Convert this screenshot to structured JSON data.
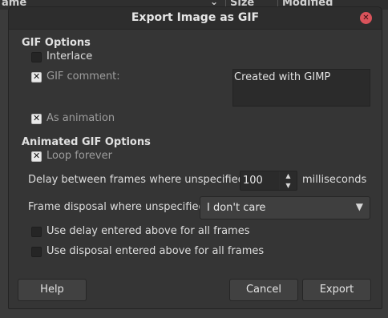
{
  "background": {
    "name_col": "ame",
    "size_col": "Size",
    "modified_col": "Modified"
  },
  "dialog": {
    "title": "Export Image as GIF",
    "close_icon": "close-icon"
  },
  "gif_options": {
    "heading": "GIF Options",
    "interlace": {
      "label": "Interlace",
      "checked": false
    },
    "gif_comment": {
      "label": "GIF comment:",
      "checked": true,
      "value": "Created with GIMP"
    },
    "as_animation": {
      "label": "As animation",
      "checked": true
    }
  },
  "animated_options": {
    "heading": "Animated GIF Options",
    "loop_forever": {
      "label": "Loop forever",
      "checked": true
    },
    "delay_label": "Delay between frames where unspecified:",
    "delay_value": "100",
    "delay_unit": "milliseconds",
    "disposal_label": "Frame disposal where unspecified:",
    "disposal_value": "I don't care",
    "use_delay": {
      "label": "Use delay entered above for all frames",
      "checked": false
    },
    "use_disposal": {
      "label": "Use disposal entered above for all frames",
      "checked": false
    }
  },
  "buttons": {
    "help": "Help",
    "cancel": "Cancel",
    "export": "Export"
  },
  "colors": {
    "dialog_bg": "#353535",
    "close_button": "#d9535b"
  }
}
